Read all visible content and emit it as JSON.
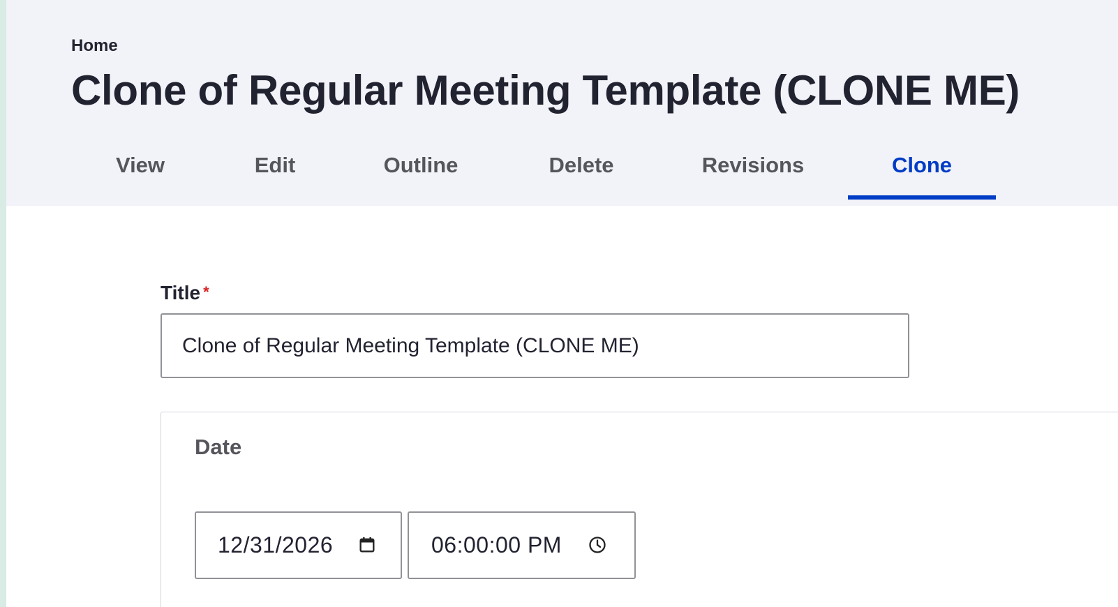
{
  "breadcrumb": {
    "home_label": "Home"
  },
  "page": {
    "title": "Clone of Regular Meeting Template (CLONE ME)"
  },
  "tabs": [
    {
      "label": "View",
      "active": false
    },
    {
      "label": "Edit",
      "active": false
    },
    {
      "label": "Outline",
      "active": false
    },
    {
      "label": "Delete",
      "active": false
    },
    {
      "label": "Revisions",
      "active": false
    },
    {
      "label": "Clone",
      "active": true
    }
  ],
  "form": {
    "title_field": {
      "label": "Title",
      "required_marker": "*",
      "value": "Clone of Regular Meeting Template (CLONE ME)"
    },
    "date_fieldset": {
      "legend": "Date",
      "date_value": "12/31/2026",
      "time_value": "06:00:00 PM"
    }
  },
  "icons": {
    "date_picker": "calendar-icon",
    "time_picker": "clock-icon"
  },
  "colors": {
    "accent": "#003cc5",
    "header_bg": "#f2f3f8",
    "required": "#d72222",
    "text": "#222330",
    "tab_text": "#55565b"
  }
}
